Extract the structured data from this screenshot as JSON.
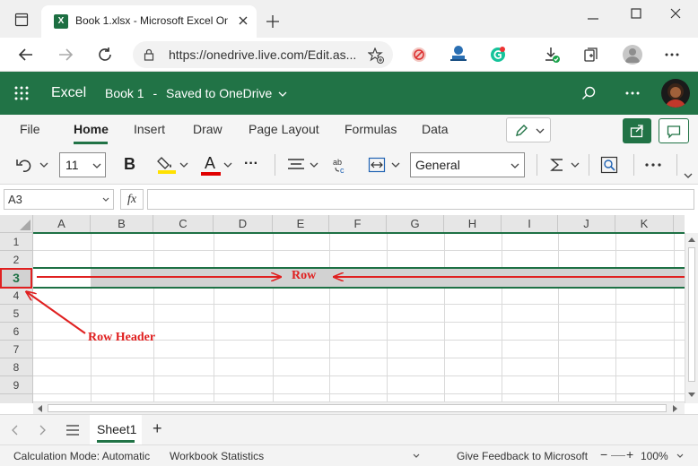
{
  "browser": {
    "tab_title": "Book 1.xlsx - Microsoft Excel Onl",
    "url": "https://onedrive.live.com/Edit.as..."
  },
  "app": {
    "name": "Excel",
    "doc_title": "Book 1",
    "saved_status": "Saved to OneDrive"
  },
  "menu": {
    "items": [
      "File",
      "Home",
      "Insert",
      "Draw",
      "Page Layout",
      "Formulas",
      "Data"
    ],
    "active": "Home"
  },
  "toolbar": {
    "font_size": "11",
    "bold_label": "B",
    "font_color_label": "A",
    "number_format": "General",
    "more_label": "···"
  },
  "formula_bar": {
    "name_box": "A3",
    "fx_label": "fx",
    "value": ""
  },
  "grid": {
    "columns": [
      "A",
      "B",
      "C",
      "D",
      "E",
      "F",
      "G",
      "H",
      "I",
      "J",
      "K"
    ],
    "rows": [
      "1",
      "2",
      "3",
      "4",
      "5",
      "6",
      "7",
      "8",
      "9"
    ],
    "selected_row": "3"
  },
  "annotations": {
    "row_label": "Row",
    "row_header_label": "Row Header"
  },
  "sheets": {
    "tabs": [
      "Sheet1"
    ],
    "add_label": "+"
  },
  "status": {
    "calc_mode": "Calculation Mode: Automatic",
    "workbook_stats": "Workbook Statistics",
    "feedback": "Give Feedback to Microsoft",
    "zoom": "100%"
  },
  "colors": {
    "excel_green": "#217346",
    "annotation_red": "#e02020",
    "selection_green": "#1e7145"
  }
}
